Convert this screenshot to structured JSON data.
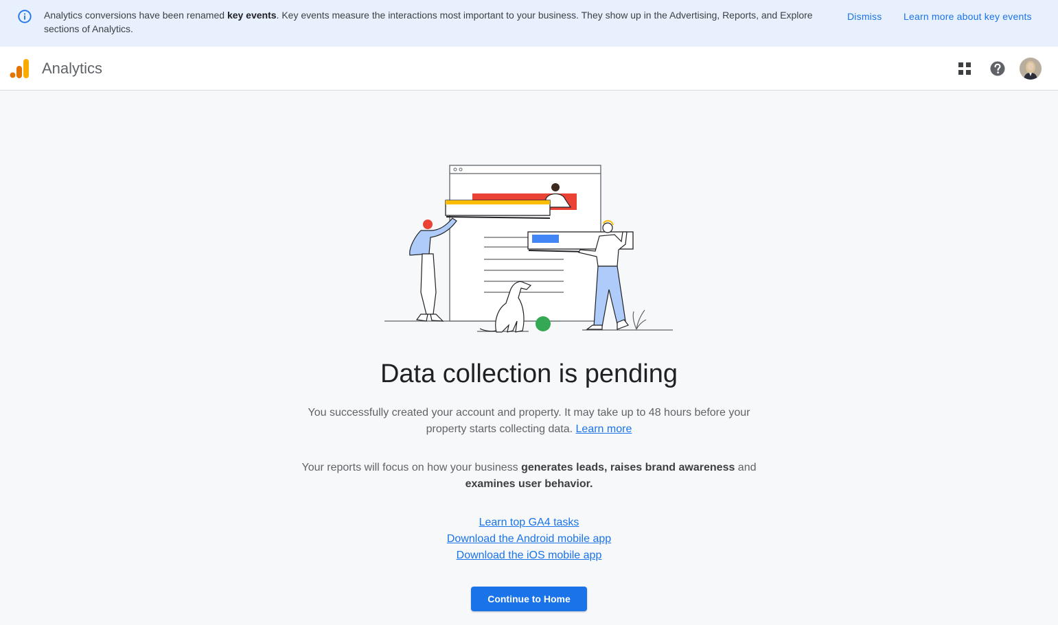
{
  "banner": {
    "text_prefix": "Analytics conversions have been renamed ",
    "text_bold": "key events",
    "text_suffix": ". Key events measure the interactions most important to your business. They show up in the Advertising, Reports, and Explore sections of Analytics.",
    "dismiss_label": "Dismiss",
    "learn_more_label": "Learn more about key events",
    "icon": "info-icon"
  },
  "header": {
    "app_title": "Analytics",
    "icons": [
      "apps-grid-icon",
      "help-icon",
      "avatar"
    ]
  },
  "main": {
    "title": "Data collection is pending",
    "para1_text": "You successfully created your account and property. It may take up to 48 hours before your property starts collecting data. ",
    "para1_link": "Learn more",
    "para2_prefix": "Your reports will focus on how your business ",
    "para2_bold1": "generates leads, raises brand awareness",
    "para2_mid": " and ",
    "para2_bold2": "examines user behavior.",
    "links": [
      "Learn top GA4 tasks",
      "Download the Android mobile app",
      "Download the iOS mobile app"
    ],
    "button_label": "Continue to Home"
  },
  "colors": {
    "banner_bg": "#e8f0fe",
    "accent": "#1a73e8",
    "logo_orange": "#f9ab00",
    "logo_dark_orange": "#e37400"
  }
}
